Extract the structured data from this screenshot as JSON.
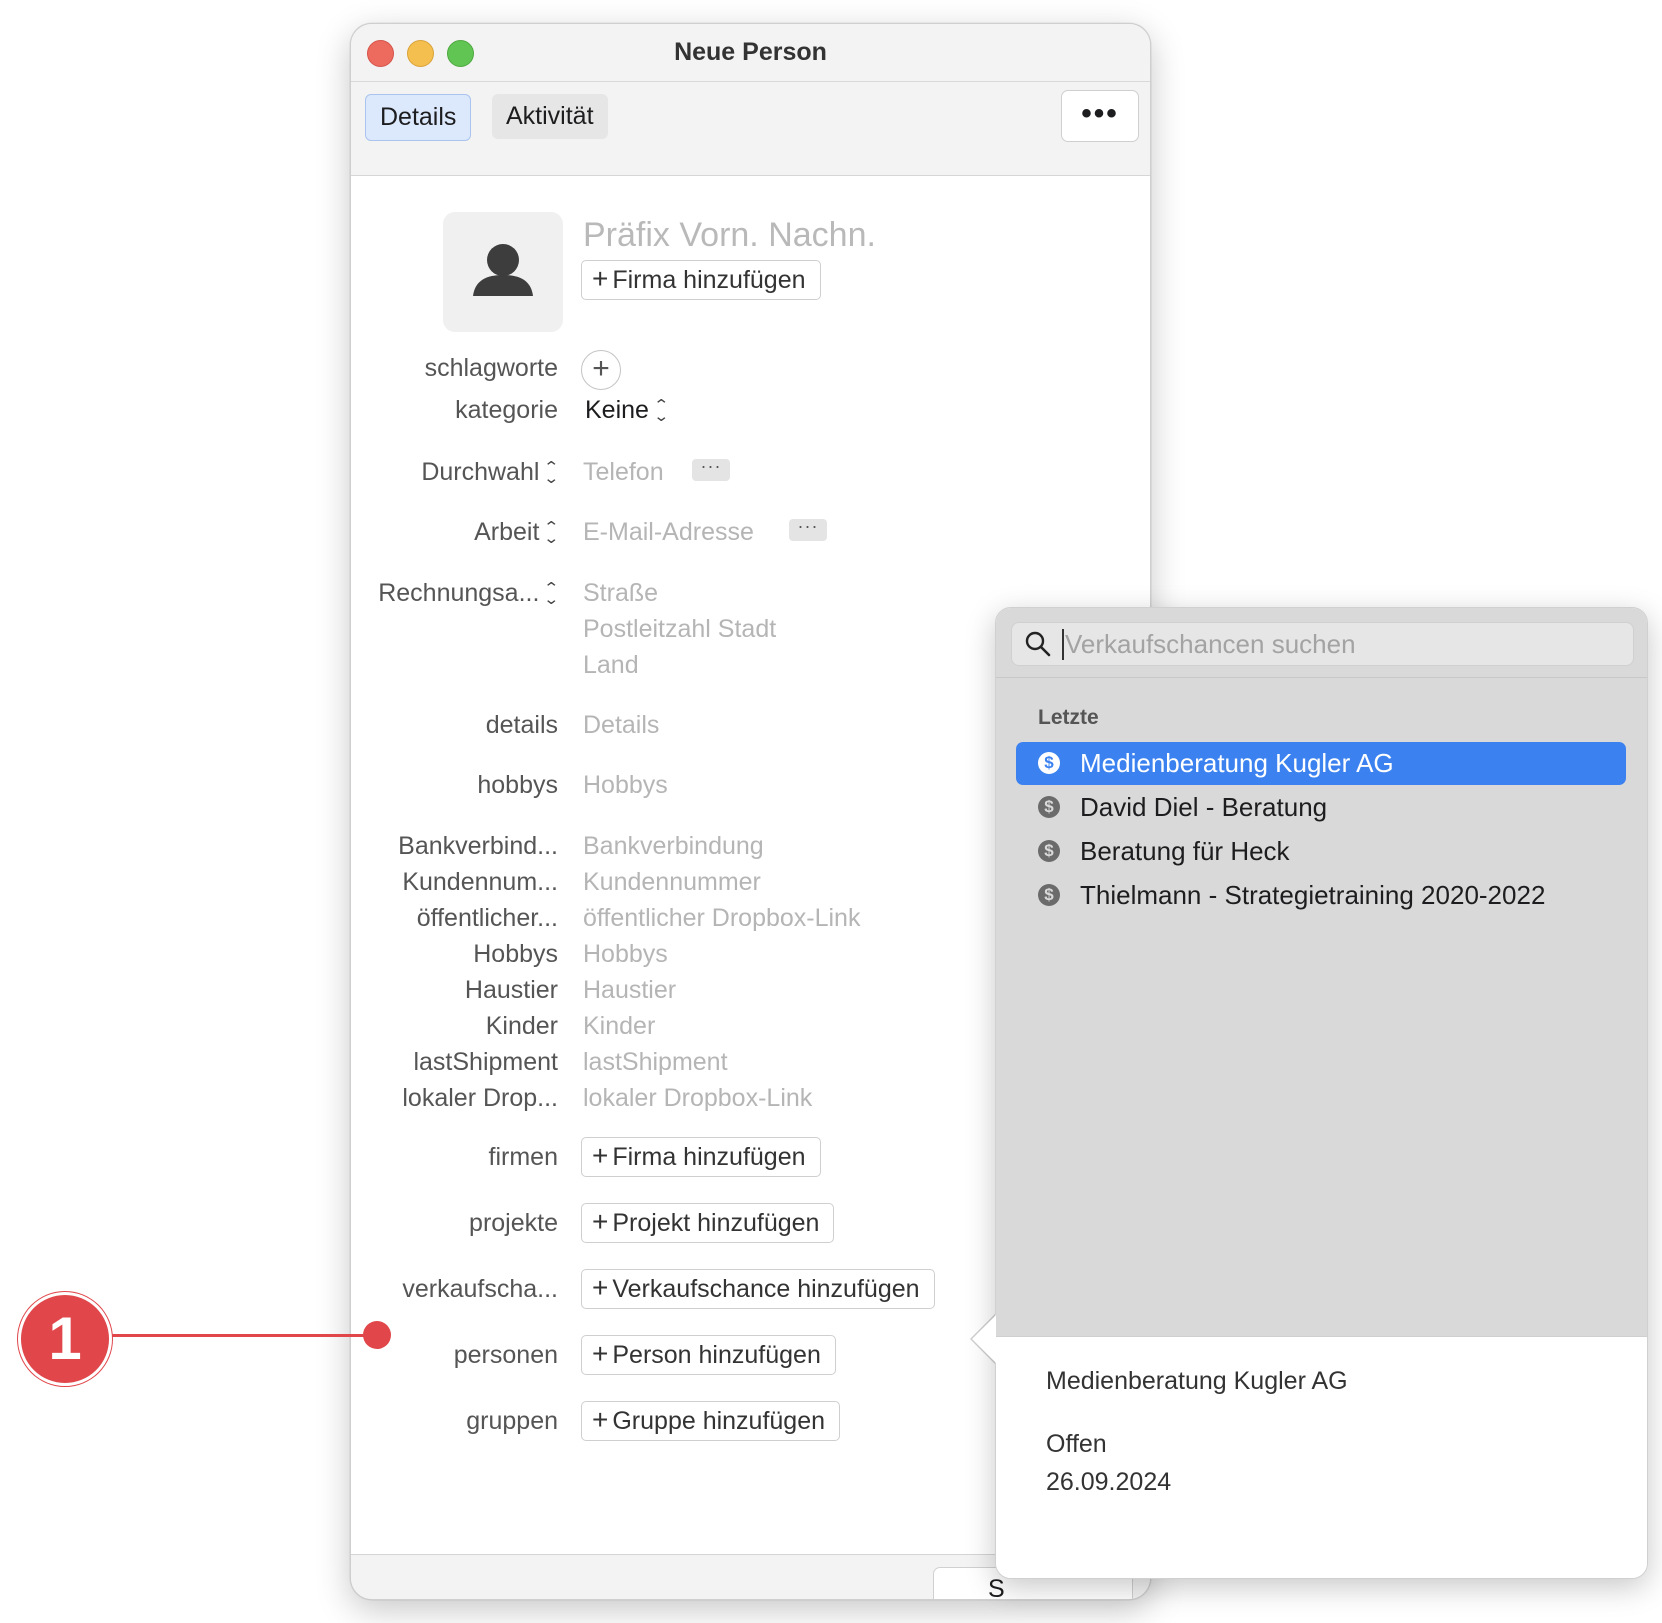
{
  "window": {
    "title": "Neue Person",
    "tabs": [
      "Details",
      "Aktivität"
    ],
    "more_label": "•••"
  },
  "header": {
    "name_placeholder": "Präfix Vorn. Nachn.",
    "add_company": "Firma hinzufügen"
  },
  "fields": {
    "tags_label": "schlagworte",
    "category_label": "kategorie",
    "category_value": "Keine",
    "phone_label": "Durchwahl",
    "phone_placeholder": "Telefon",
    "email_label": "Arbeit",
    "email_placeholder": "E-Mail-Adresse",
    "address_label": "Rechnungsa...",
    "address_street": "Straße",
    "address_city": "Postleitzahl Stadt",
    "address_country": "Land",
    "details_label": "details",
    "details_placeholder": "Details",
    "hobbys_label": "hobbys",
    "hobbys_placeholder": "Hobbys"
  },
  "custom_fields": [
    {
      "label": "Bankverbind...",
      "placeholder": "Bankverbindung"
    },
    {
      "label": "Kundennum...",
      "placeholder": "Kundennummer"
    },
    {
      "label": "öffentlicher...",
      "placeholder": "öffentlicher Dropbox-Link"
    },
    {
      "label": "Hobbys",
      "placeholder": "Hobbys"
    },
    {
      "label": "Haustier",
      "placeholder": "Haustier"
    },
    {
      "label": "Kinder",
      "placeholder": "Kinder"
    },
    {
      "label": "lastShipment",
      "placeholder": "lastShipment"
    },
    {
      "label": "lokaler Drop...",
      "placeholder": "lokaler Dropbox-Link"
    }
  ],
  "relations": [
    {
      "label": "firmen",
      "button": "Firma hinzufügen"
    },
    {
      "label": "projekte",
      "button": "Projekt hinzufügen"
    },
    {
      "label": "verkaufscha...",
      "button": "Verkaufschance hinzufügen"
    },
    {
      "label": "personen",
      "button": "Person hinzufügen"
    },
    {
      "label": "gruppen",
      "button": "Gruppe hinzufügen"
    }
  ],
  "footer": {
    "save_label": "S"
  },
  "popover": {
    "search_placeholder": "Verkaufschancen suchen",
    "section": "Letzte",
    "items": [
      {
        "label": "Medienberatung Kugler AG",
        "selected": true
      },
      {
        "label": "David Diel - Beratung",
        "selected": false
      },
      {
        "label": "Beratung für Heck",
        "selected": false
      },
      {
        "label": "Thielmann - Strategietraining 2020-2022",
        "selected": false
      }
    ],
    "detail": {
      "name": "Medienberatung Kugler AG",
      "status": "Offen",
      "date": "26.09.2024"
    }
  },
  "annotation": {
    "number": "1"
  },
  "colors": {
    "accent": "#3b82f0",
    "annotation": "#e0464a"
  }
}
